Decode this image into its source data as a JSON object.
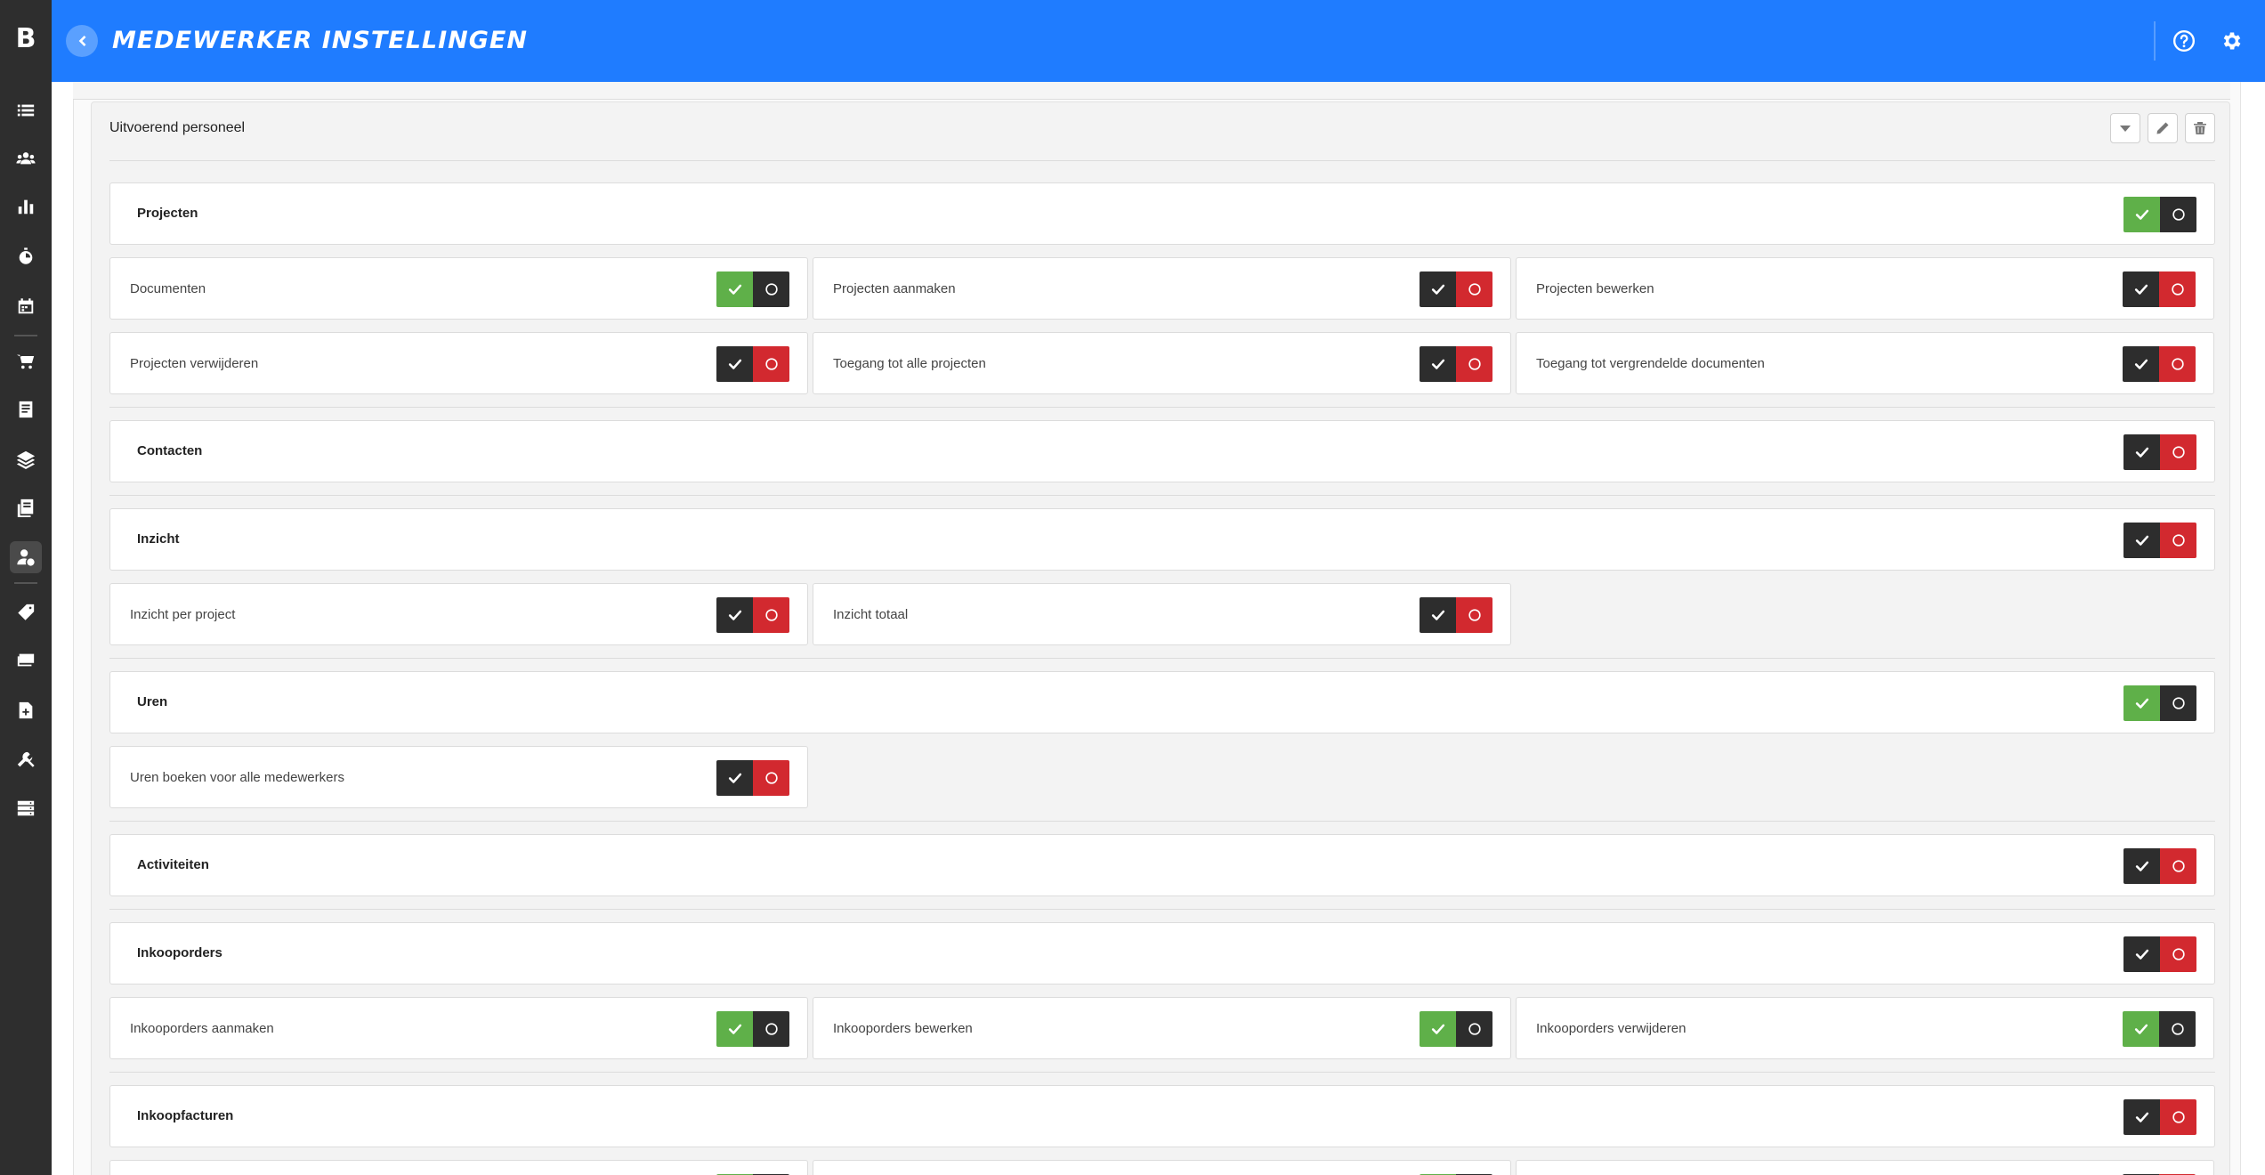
{
  "header": {
    "title": "MEDEWERKER INSTELLINGEN"
  },
  "sidebar": {
    "logo": "B",
    "items": [
      {
        "icon": "list-icon"
      },
      {
        "icon": "users-icon"
      },
      {
        "icon": "bar-chart-icon"
      },
      {
        "icon": "stopwatch-icon"
      },
      {
        "icon": "calendar-icon"
      },
      {
        "icon": "cart-icon"
      },
      {
        "icon": "document-icon"
      },
      {
        "icon": "layers-icon"
      },
      {
        "icon": "invoice-icon"
      },
      {
        "icon": "user-settings-icon",
        "active": true
      },
      {
        "icon": "tag-icon"
      },
      {
        "icon": "stack-icon"
      },
      {
        "icon": "add-document-icon"
      },
      {
        "icon": "tools-icon"
      },
      {
        "icon": "server-icon"
      }
    ]
  },
  "group": {
    "title": "Uitvoerend personeel"
  },
  "colors": {
    "header": "#1f7cff",
    "on": "#5fb049",
    "off": "#d2292f",
    "neutral": "#2d2d2d"
  },
  "sections": [
    {
      "label": "Projecten",
      "state": "on",
      "items": [
        {
          "label": "Documenten",
          "state": "on"
        },
        {
          "label": "Projecten aanmaken",
          "state": "off"
        },
        {
          "label": "Projecten bewerken",
          "state": "off"
        },
        {
          "label": "Projecten verwijderen",
          "state": "off"
        },
        {
          "label": "Toegang tot alle projecten",
          "state": "off"
        },
        {
          "label": "Toegang tot vergrendelde documenten",
          "state": "off"
        }
      ]
    },
    {
      "label": "Contacten",
      "state": "off",
      "items": []
    },
    {
      "label": "Inzicht",
      "state": "off",
      "items": [
        {
          "label": "Inzicht per project",
          "state": "off"
        },
        {
          "label": "Inzicht totaal",
          "state": "off"
        }
      ]
    },
    {
      "label": "Uren",
      "state": "on",
      "items": [
        {
          "label": "Uren boeken voor alle medewerkers",
          "state": "off"
        }
      ]
    },
    {
      "label": "Activiteiten",
      "state": "off",
      "items": []
    },
    {
      "label": "Inkooporders",
      "state": "off",
      "items": [
        {
          "label": "Inkooporders aanmaken",
          "state": "on"
        },
        {
          "label": "Inkooporders bewerken",
          "state": "on"
        },
        {
          "label": "Inkooporders verwijderen",
          "state": "on"
        }
      ]
    },
    {
      "label": "Inkoopfacturen",
      "state": "off",
      "items": [
        {
          "label": "",
          "state": "on"
        },
        {
          "label": "",
          "state": "on"
        },
        {
          "label": "",
          "state": "off"
        }
      ]
    }
  ]
}
